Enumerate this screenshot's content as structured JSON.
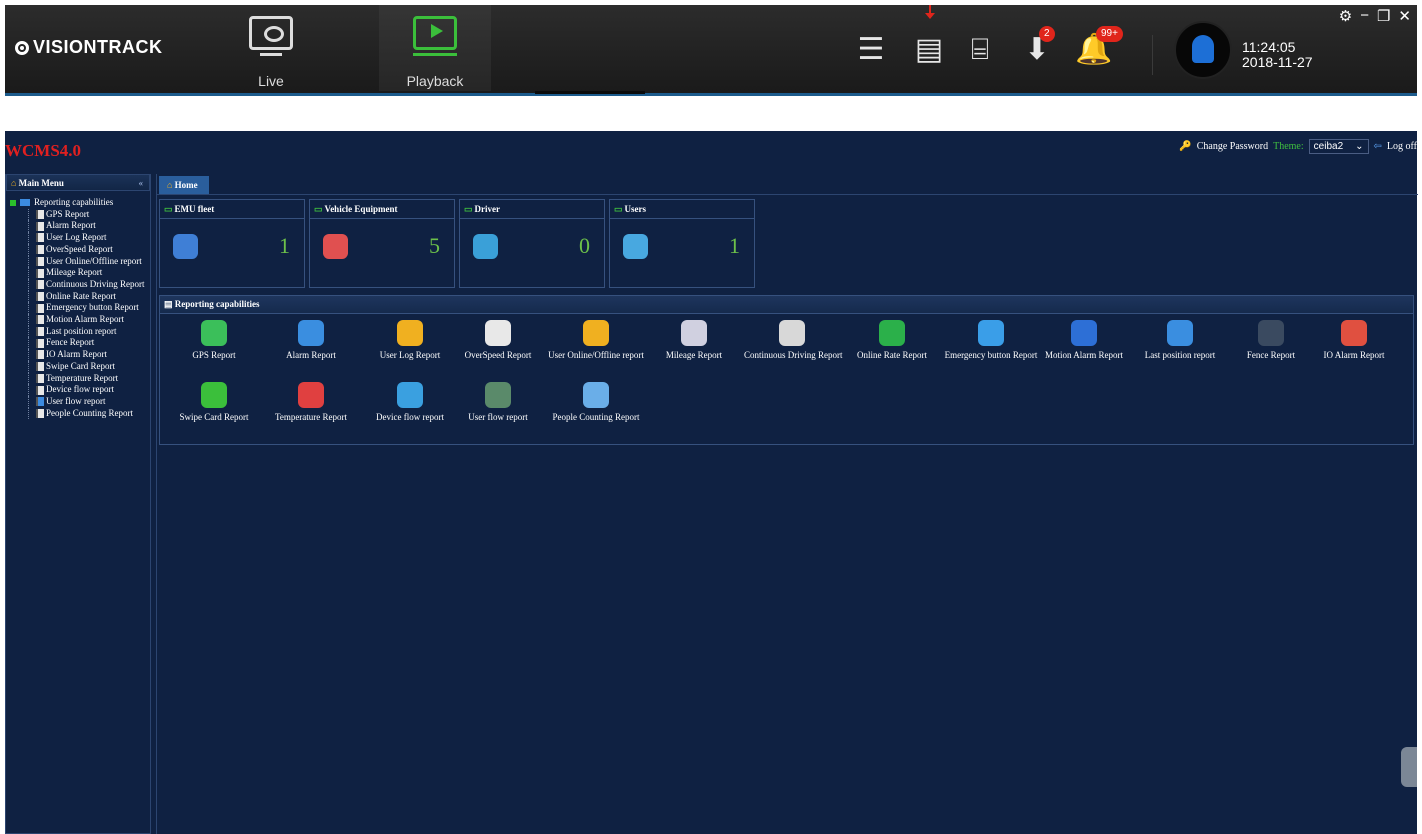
{
  "topbar": {
    "brand": "VISIONTRACK",
    "nav": [
      {
        "label": "Live"
      },
      {
        "label": "Playback"
      }
    ],
    "icons": [
      "list-icon",
      "document-icon",
      "inbox-icon",
      "download-icon",
      "bell-icon"
    ],
    "badges": {
      "download": "2",
      "bell": "99+"
    },
    "time": "11:24:05",
    "date": "2018-11-27"
  },
  "wcms": {
    "title": "WCMS4.0",
    "change_password": "Change Password",
    "theme_label": "Theme:",
    "theme_value": "ceiba2",
    "logoff": "Log off"
  },
  "sidebar": {
    "header": "Main Menu",
    "root": "Reporting capabilities",
    "items": [
      "GPS Report",
      "Alarm Report",
      "User Log Report",
      "OverSpeed Report",
      "User Online/Offline report",
      "Mileage Report",
      "Continuous Driving Report",
      "Online Rate Report",
      "Emergency button Report",
      "Motion Alarm Report",
      "Last position report",
      "Fence Report",
      "IO Alarm Report",
      "Swipe Card Report",
      "Temperature Report",
      "Device flow report",
      "User flow report",
      "People Counting Report"
    ]
  },
  "main": {
    "tab": "Home",
    "cards": [
      {
        "title": "EMU fleet",
        "value": "1",
        "color": "#3f7fd6"
      },
      {
        "title": "Vehicle Equipment",
        "value": "5",
        "color": "#e05050"
      },
      {
        "title": "Driver",
        "value": "0",
        "color": "#3aa0d8"
      },
      {
        "title": "Users",
        "value": "1",
        "color": "#48a8e0"
      }
    ],
    "panel_title": "Reporting capabilities",
    "reports": [
      {
        "label": "GPS Report",
        "color": "#3bbf5a"
      },
      {
        "label": "Alarm Report",
        "color": "#3a8ee0"
      },
      {
        "label": "User Log Report",
        "color": "#f0b020"
      },
      {
        "label": "OverSpeed Report",
        "color": "#e8e8e8"
      },
      {
        "label": "User Online/Offline report",
        "color": "#f0b020"
      },
      {
        "label": "Mileage Report",
        "color": "#d0d0e0"
      },
      {
        "label": "Continuous Driving Report",
        "color": "#d8d8d8"
      },
      {
        "label": "Online Rate Report",
        "color": "#2bb04a"
      },
      {
        "label": "Emergency button Report",
        "color": "#3a9ee8"
      },
      {
        "label": "Motion Alarm Report",
        "color": "#2d6fd6"
      },
      {
        "label": "Last position report",
        "color": "#3a8ee0"
      },
      {
        "label": "Fence Report",
        "color": "#3a4a60"
      },
      {
        "label": "IO Alarm Report",
        "color": "#e05040"
      },
      {
        "label": "Swipe Card Report",
        "color": "#3bbf3b"
      },
      {
        "label": "Temperature Report",
        "color": "#e04040"
      },
      {
        "label": "Device flow report",
        "color": "#3aa0e0"
      },
      {
        "label": "User flow report",
        "color": "#5a8a6a"
      },
      {
        "label": "People Counting Report",
        "color": "#6aaee8"
      }
    ]
  }
}
